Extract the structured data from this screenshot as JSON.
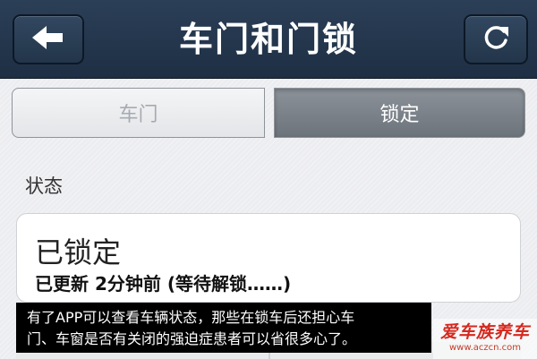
{
  "header": {
    "title": "车门和门锁",
    "back_icon": "arrow-left-icon",
    "refresh_icon": "refresh-icon"
  },
  "segmented_control": {
    "options": [
      "车门",
      "锁定"
    ],
    "selected": "锁定"
  },
  "status_section": {
    "label": "状态",
    "status_text": "已锁定",
    "updated_prefix": "已更新",
    "updated_number": "2",
    "updated_suffix": "分钟前 (等待解锁……)"
  },
  "caption": {
    "lines": [
      "有了APP可以查看车辆状态，那些在锁车后还担心车",
      "门、车窗是否有关闭的强迫症患者可以省很多心了。"
    ]
  },
  "watermark": {
    "title": "爱车族养车",
    "url": "www.aczcn.com"
  },
  "colors": {
    "navbar": "#24374d",
    "selected_segment": "#7a8088",
    "background": "#ecedf0",
    "watermark_red": "#d6281e"
  }
}
